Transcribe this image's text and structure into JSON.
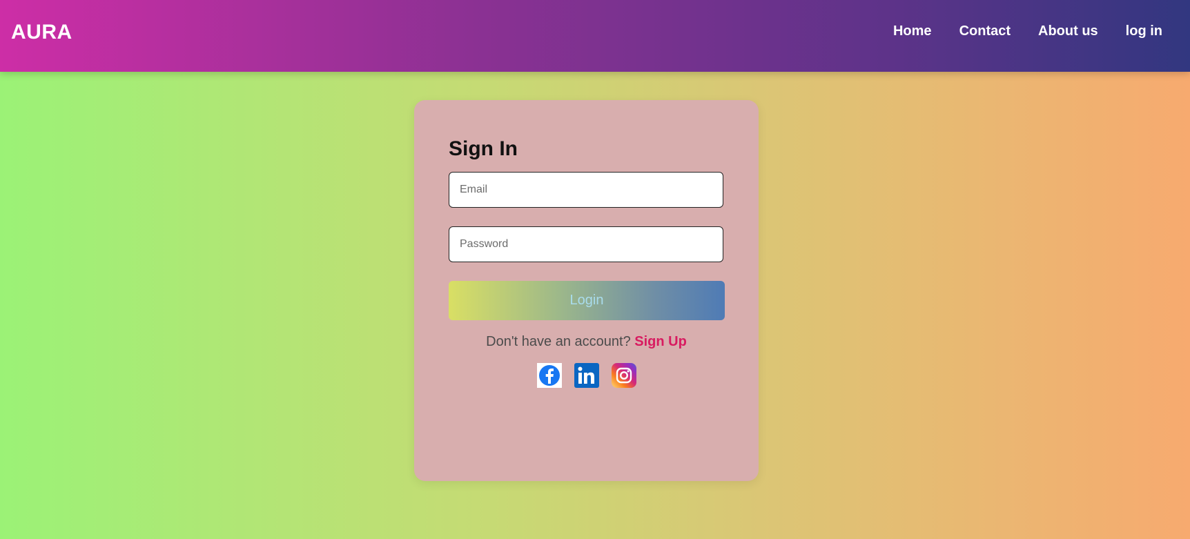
{
  "navbar": {
    "brand": "AURA",
    "links": [
      {
        "label": "Home"
      },
      {
        "label": "Contact"
      },
      {
        "label": "About us"
      },
      {
        "label": "log in"
      }
    ]
  },
  "signin": {
    "title": "Sign In",
    "email_placeholder": "Email",
    "password_placeholder": "Password",
    "login_label": "Login",
    "signup_prompt": "Don't have an account?",
    "signup_link": "Sign Up"
  },
  "socials": [
    {
      "icon": "facebook-icon"
    },
    {
      "icon": "linkedin-icon"
    },
    {
      "icon": "instagram-icon"
    }
  ],
  "colors": {
    "accent": "#d81b60",
    "card": "#d8aeae",
    "facebook": "#1877f2",
    "linkedin": "#0a66c2"
  }
}
